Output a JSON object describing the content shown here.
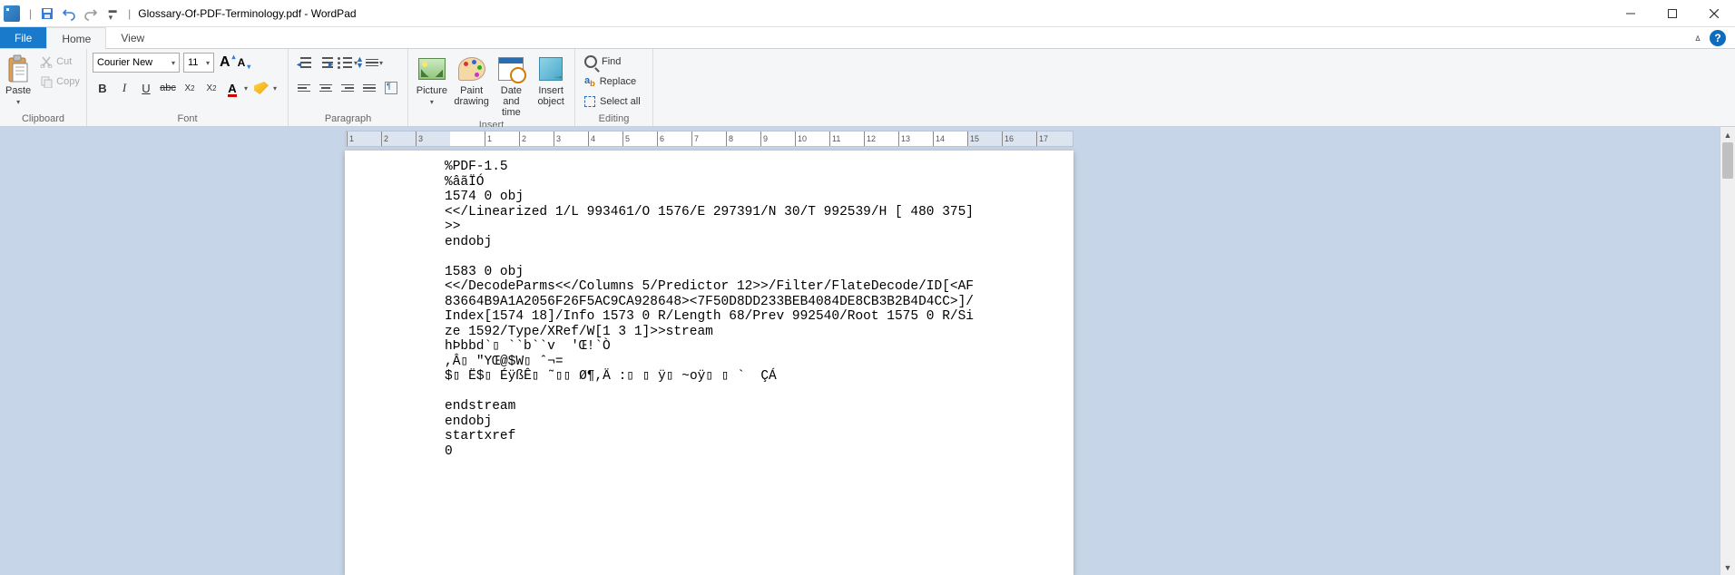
{
  "title": "Glossary-Of-PDF-Terminology.pdf - WordPad",
  "tabs": {
    "file": "File",
    "home": "Home",
    "view": "View"
  },
  "clipboard": {
    "paste": "Paste",
    "cut": "Cut",
    "copy": "Copy",
    "label": "Clipboard"
  },
  "font": {
    "name": "Courier New",
    "size": "11",
    "label": "Font"
  },
  "paragraph": {
    "label": "Paragraph"
  },
  "insert": {
    "picture": "Picture",
    "paint": "Paint drawing",
    "datetime": "Date and time",
    "object": "Insert object",
    "label": "Insert"
  },
  "editing": {
    "find": "Find",
    "replace": "Replace",
    "selectall": "Select all",
    "label": "Editing"
  },
  "ruler": {
    "left_labels": [
      "3",
      "2",
      "1"
    ],
    "right_labels": [
      "1",
      "2",
      "3",
      "4",
      "5",
      "6",
      "7",
      "8",
      "9",
      "10",
      "11",
      "12",
      "13",
      "14",
      "15",
      "16",
      "17"
    ]
  },
  "document_lines": [
    "%PDF-1.5",
    "%âãÏÓ",
    "1574 0 obj",
    "<</Linearized 1/L 993461/O 1576/E 297391/N 30/T 992539/H [ 480 375]>>",
    "endobj",
    "",
    "1583 0 obj",
    "<</DecodeParms<</Columns 5/Predictor 12>>/Filter/FlateDecode/ID[<AF83664B9A1A2056F26F5AC9CA928648><7F50D8DD233BEB4084DE8CB3B2B4D4CC>]/Index[1574 18]/Info 1573 0 R/Length 68/Prev 992540/Root 1575 0 R/Size 1592/Type/XRef/W[1 3 1]>>stream",
    "hÞbbd`▯ ``b``v  'Œ!`Ò",
    ",Â▯ \"YŒ@$W▯ ˆ¬=",
    "$▯ Ë$▯ ÉÿßÊ▯ ˜▯▯ Ø¶,Ä :▯ ▯ ÿ▯ ~oÿ▯ ▯ `  ÇÁ",
    "",
    "endstream",
    "endobj",
    "startxref",
    "0"
  ]
}
